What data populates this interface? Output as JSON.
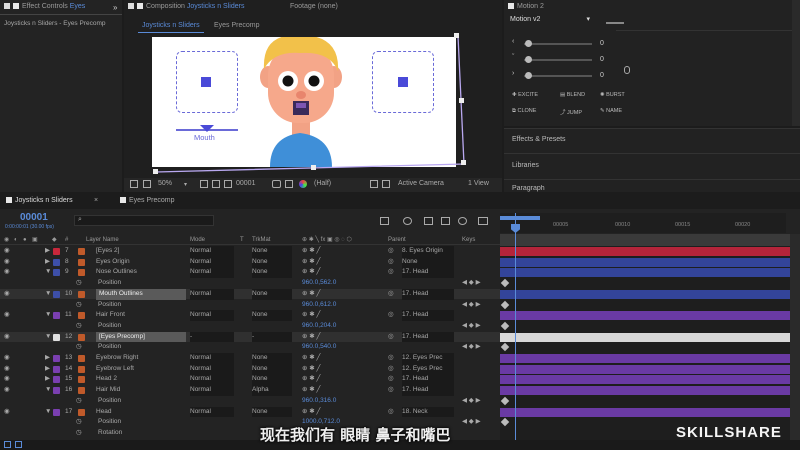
{
  "effect_controls": {
    "tab_label": "Effect Controls",
    "tab_target": "Eyes",
    "subtitle": "Joysticks n Sliders - Eyes Precomp"
  },
  "composition": {
    "tab_label": "Composition",
    "tab_target": "Joysticks n Sliders",
    "footage_tab": "Footage (none)",
    "subtabs": [
      "Joysticks n Sliders",
      "Eyes Precomp"
    ],
    "mouth_label": "Mouth"
  },
  "viewer": {
    "zoom": "50%",
    "timecode": "00001",
    "resolution": "(Half)",
    "camera": "Active Camera",
    "views": "1 View"
  },
  "motion": {
    "panel_title": "Motion 2",
    "version": "Motion v2",
    "sliders": [
      {
        "label": "0"
      },
      {
        "label": "0"
      },
      {
        "label": "0"
      }
    ],
    "actions": [
      "EXCITE",
      "BLEND",
      "BURST",
      "CLONE",
      "JUMP",
      "NAME"
    ]
  },
  "side_panels": [
    "Effects & Presets",
    "Libraries",
    "Paragraph"
  ],
  "timeline": {
    "tabs": [
      "Joysticks n Sliders",
      "Eyes Precomp"
    ],
    "timecode": "00001",
    "timecode_sub": "0:00:00:01 (30.00 fps)",
    "ruler": [
      "00005",
      "00010",
      "00015",
      "00020"
    ],
    "headers": {
      "num": "#",
      "layer": "Layer Name",
      "mode": "Mode",
      "t": "T",
      "trkmat": "TrkMat",
      "parent": "Parent",
      "keys": "Keys"
    },
    "rows": [
      {
        "type": "layer",
        "num": "7",
        "name": "[Eyes 2]",
        "mode": "Normal",
        "trkmat": "None",
        "parent": "8. Eyes Origin",
        "label": "#c8273b",
        "bar": "#b5243a"
      },
      {
        "type": "layer",
        "num": "8",
        "name": "Eyes Origin",
        "mode": "Normal",
        "trkmat": "None",
        "parent": "None",
        "label": "#3d4fa8",
        "bar": "#33449a"
      },
      {
        "type": "layer",
        "num": "9",
        "name": "Nose Outlines",
        "mode": "Normal",
        "trkmat": "None",
        "parent": "17. Head",
        "label": "#3d4fa8",
        "bar": "#33449a"
      },
      {
        "type": "prop",
        "name": "Position",
        "value": "960.0,562.0"
      },
      {
        "type": "layer",
        "num": "10",
        "name": "Mouth Outlines",
        "mode": "Normal",
        "trkmat": "None",
        "parent": "17. Head",
        "label": "#3d4fa8",
        "bar": "#33449a"
      },
      {
        "type": "prop",
        "name": "Position",
        "value": "960.0,612.0"
      },
      {
        "type": "layer",
        "num": "11",
        "name": "Hair Front",
        "mode": "Normal",
        "trkmat": "None",
        "parent": "17. Head",
        "label": "#7a3fb0",
        "bar": "#6a3aa4"
      },
      {
        "type": "prop",
        "name": "Position",
        "value": "960.0,204.0"
      },
      {
        "type": "layer",
        "num": "12",
        "name": "[Eyes Precomp]",
        "mode": "-",
        "trkmat": "-",
        "parent": "17. Head",
        "label": "#e0e0e0",
        "bar": "#d8d8d8"
      },
      {
        "type": "prop",
        "name": "Position",
        "value": "960.0,540.0"
      },
      {
        "type": "layer",
        "num": "13",
        "name": "Eyebrow Right",
        "mode": "Normal",
        "trkmat": "None",
        "parent": "12. Eyes Prec",
        "label": "#7a3fb0",
        "bar": "#6a3aa4"
      },
      {
        "type": "layer",
        "num": "14",
        "name": "Eyebrow Left",
        "mode": "Normal",
        "trkmat": "None",
        "parent": "12. Eyes Prec",
        "label": "#7a3fb0",
        "bar": "#6a3aa4"
      },
      {
        "type": "layer",
        "num": "15",
        "name": "Head 2",
        "mode": "Normal",
        "trkmat": "None",
        "parent": "17. Head",
        "label": "#7a3fb0",
        "bar": "#6a3aa4"
      },
      {
        "type": "layer",
        "num": "16",
        "name": "Hair Mid",
        "mode": "Normal",
        "trkmat": "Alpha",
        "parent": "17. Head",
        "label": "#7a3fb0",
        "bar": "#6a3aa4"
      },
      {
        "type": "prop",
        "name": "Position",
        "value": "960.0,316.0"
      },
      {
        "type": "layer",
        "num": "17",
        "name": "Head",
        "mode": "Normal",
        "trkmat": "None",
        "parent": "18. Neck",
        "label": "#7a3fb0",
        "bar": "#6a3aa4"
      },
      {
        "type": "prop",
        "name": "Position",
        "value": "1000.0,712.0"
      },
      {
        "type": "prop",
        "name": "Rotation",
        "value": ""
      }
    ]
  },
  "subtitle": "现在我们有 眼睛 鼻子和嘴巴",
  "watermark": "SKILLSHARE"
}
